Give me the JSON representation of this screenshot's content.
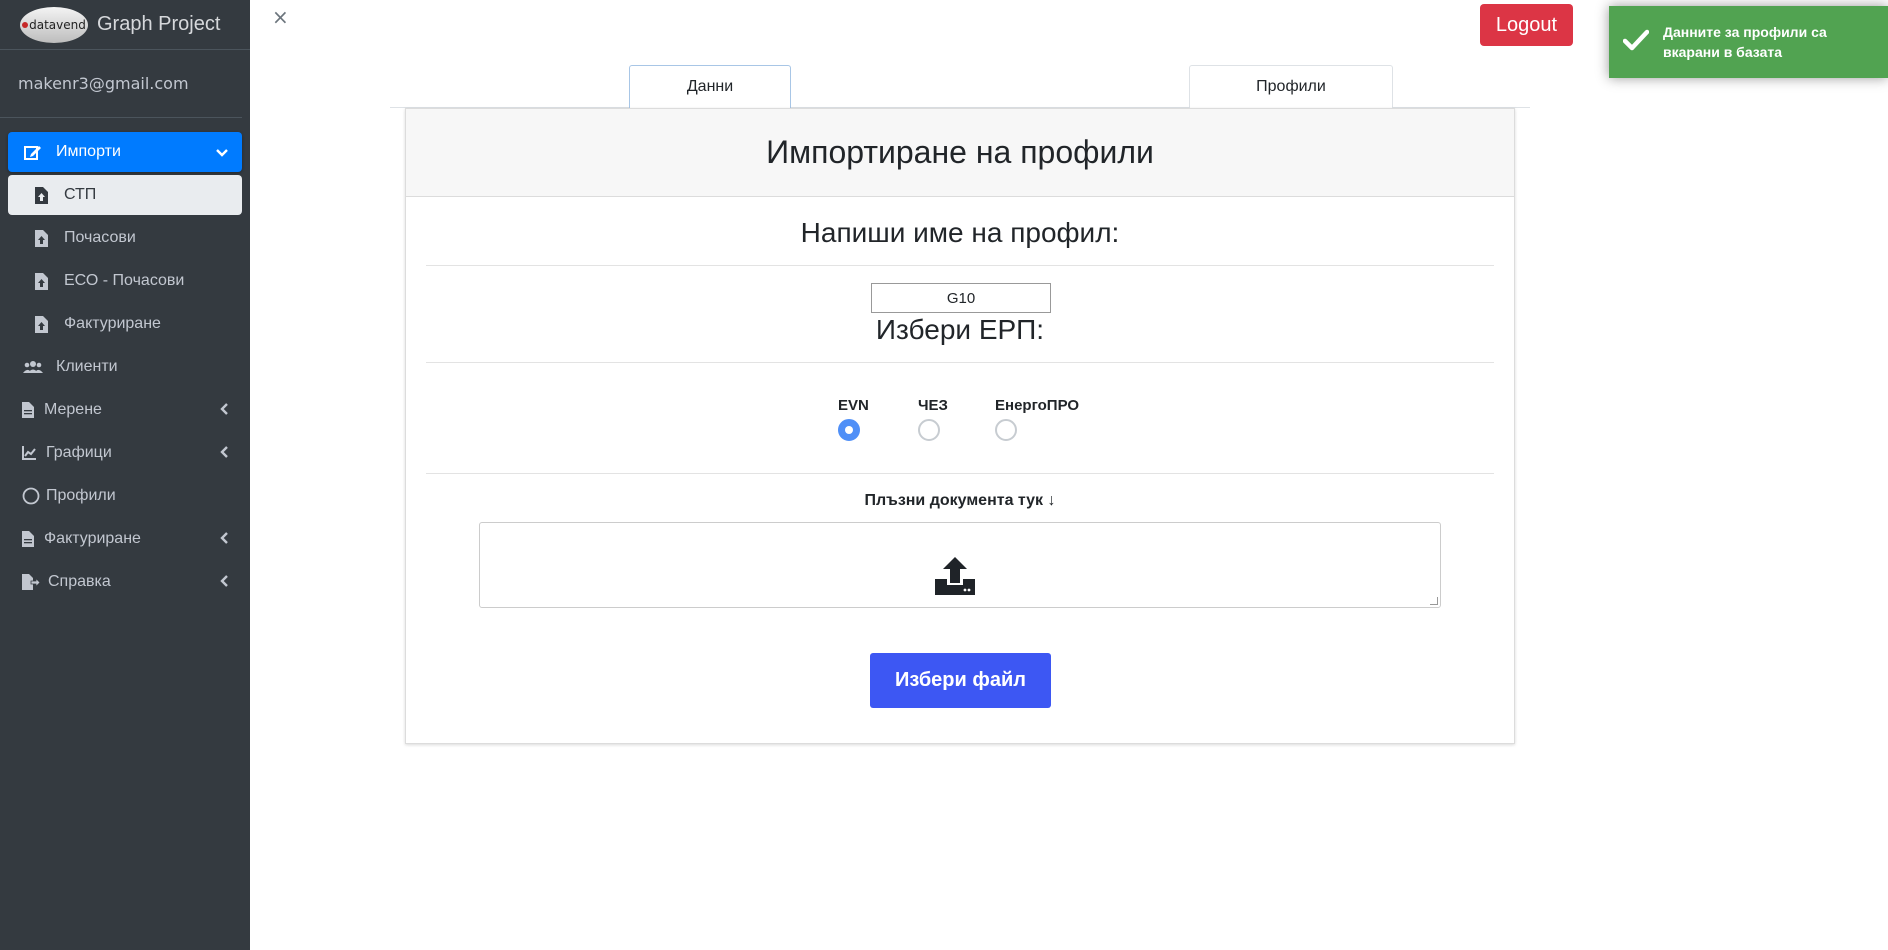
{
  "brand": {
    "logo_text": "datavend",
    "title": "Graph Project"
  },
  "user": {
    "email": "makenr3@gmail.com"
  },
  "sidebar": {
    "items": [
      {
        "label": "Импорти"
      },
      {
        "label": "СТП"
      },
      {
        "label": "Почасови"
      },
      {
        "label": "ЕСО - Почасови"
      },
      {
        "label": "Фактуриране"
      },
      {
        "label": "Клиенти"
      },
      {
        "label": "Мерене"
      },
      {
        "label": "Графици"
      },
      {
        "label": "Профили"
      },
      {
        "label": "Фактуриране"
      },
      {
        "label": "Справка"
      }
    ]
  },
  "header": {
    "close": "×",
    "logout_label": "Logout"
  },
  "toast": {
    "message": "Данните за профили са вкарани в базата"
  },
  "tabs": [
    {
      "label": "Данни"
    },
    {
      "label": "Профили"
    }
  ],
  "card": {
    "title": "Импортиране на профили",
    "name_prompt": "Напиши име на профил:",
    "name_value": "G10",
    "erp_prompt": "Избери ЕРП:",
    "erp_options": [
      {
        "label": "EVN",
        "checked": true
      },
      {
        "label": "ЧЕЗ",
        "checked": false
      },
      {
        "label": "ЕнергоПРО",
        "checked": false
      }
    ],
    "drop_label": "Плъзни документа тук",
    "drop_arrow": "↓",
    "choose_label": "Избери файл"
  },
  "colors": {
    "sidebar": "#343a40",
    "active": "#007bff",
    "logout": "#dc3545",
    "toast": "#51a351",
    "choose": "#3d57f3"
  }
}
